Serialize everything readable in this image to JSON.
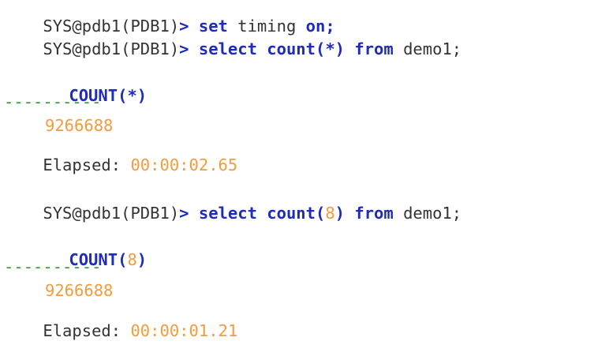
{
  "prompt": {
    "text": "SYS@pdb1(PDB1)",
    "arrow": ">"
  },
  "commands": [
    {
      "keywords": [
        "set",
        "timing",
        "on;"
      ],
      "display": "set timing on;"
    },
    {
      "keywords": [
        "select",
        "count",
        "from"
      ],
      "display": "select count(*) from demo1;",
      "table": "demo1;"
    },
    {
      "keywords": [
        "select",
        "count",
        "from"
      ],
      "display": "select count(8) from demo1;",
      "table": "demo1;"
    }
  ],
  "result1": {
    "header_left": "COUNT(",
    "header_arg": "*",
    "header_right": ")",
    "dashes": "----------",
    "value": "9266688",
    "elapsed_label": "Elapsed:",
    "elapsed_value": "00:00:02.65"
  },
  "result2": {
    "header_left": "COUNT(",
    "header_arg": "8",
    "header_right": ")",
    "dashes": "----------",
    "value": "9266688",
    "elapsed_label": "Elapsed:",
    "elapsed_value": "00:00:01.21"
  },
  "colors": {
    "keyword": "#1f2bbd",
    "number": "#f39c3d",
    "dashes": "#2e9a2e",
    "text": "#333333"
  }
}
